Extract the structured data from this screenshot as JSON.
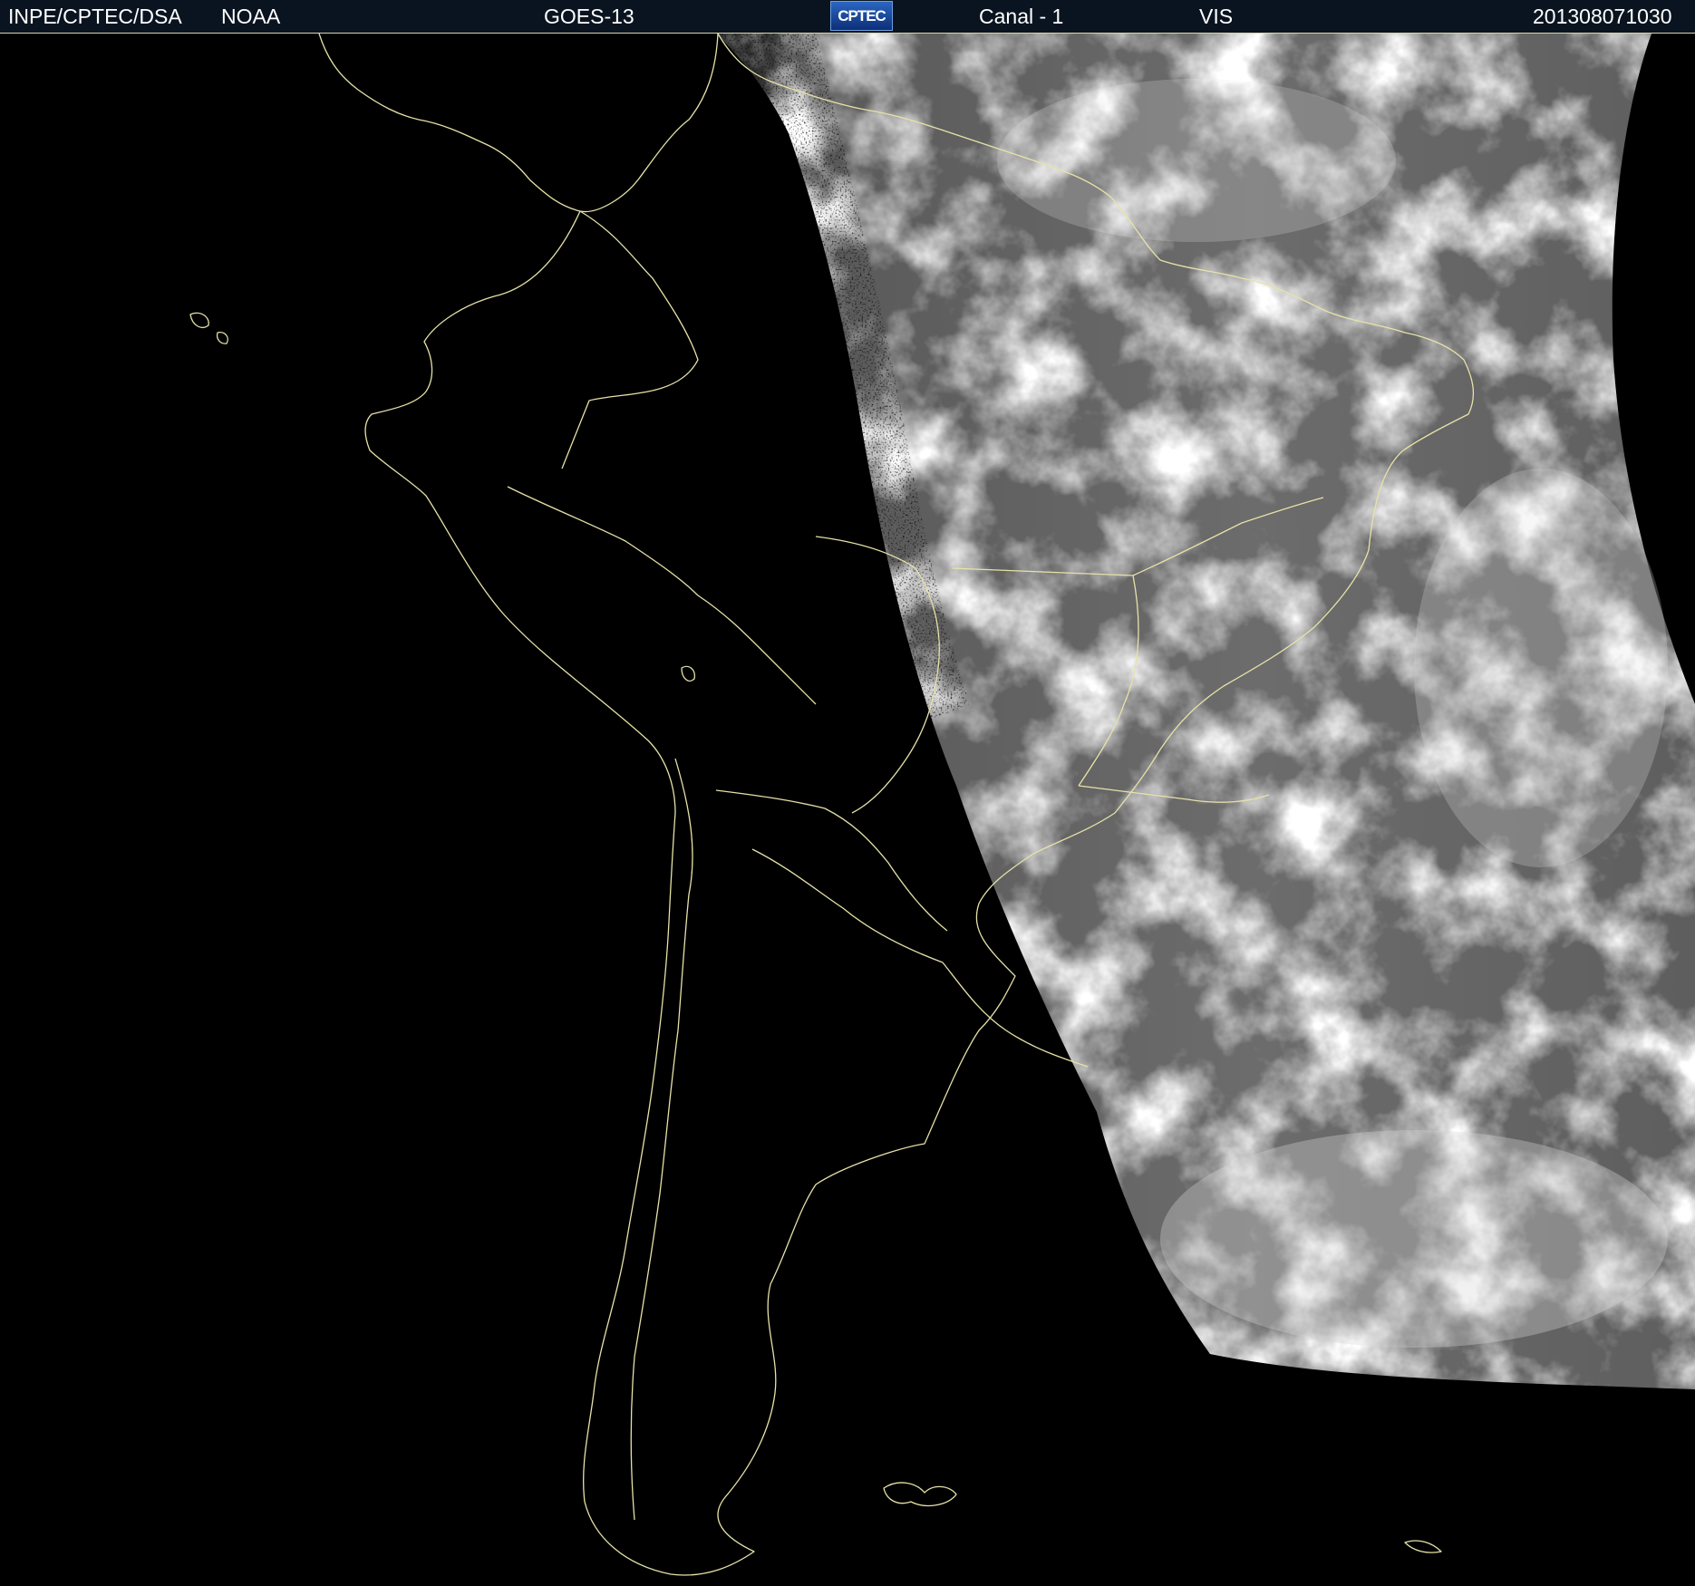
{
  "header": {
    "agency": "INPE/CPTEC/DSA",
    "source": "NOAA",
    "satellite": "GOES-13",
    "logo_text": "CPTEC",
    "channel": "Canal - 1",
    "band": "VIS",
    "timestamp": "201308071030"
  },
  "colors": {
    "background": "#000000",
    "header_bar": "#0a1420",
    "header_text": "#ffffff",
    "coastline": "#e6e2a8",
    "logo_fill": "#1e4fa8"
  }
}
